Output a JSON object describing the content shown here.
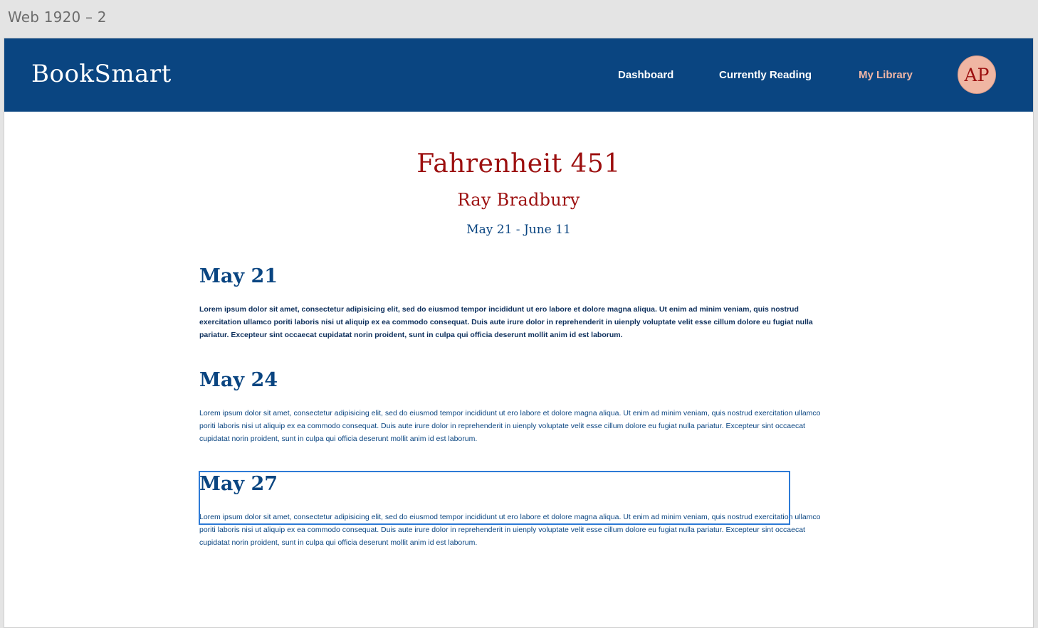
{
  "canvas": {
    "label": "Web 1920 – 2"
  },
  "navbar": {
    "brand": "BookSmart",
    "links": [
      {
        "label": "Dashboard"
      },
      {
        "label": "Currently Reading"
      },
      {
        "label": "My Library"
      }
    ],
    "avatar_initials": "AP"
  },
  "book": {
    "title": "Fahrenheit 451",
    "author": "Ray Bradbury",
    "dates": "May 21 - June 11"
  },
  "entries": [
    {
      "date": "May 21",
      "text": "Lorem ipsum dolor sit amet, consectetur adipisicing elit, sed do eiusmod tempor incididunt ut ero labore et dolore magna aliqua. Ut enim ad minim veniam, quis nostrud exercitation ullamco poriti laboris nisi ut aliquip ex ea commodo consequat. Duis aute irure dolor in reprehenderit in uienply voluptate velit esse cillum dolore eu fugiat nulla pariatur. Excepteur sint occaecat cupidatat norin proident, sunt in culpa qui officia deserunt mollit anim id est laborum."
    },
    {
      "date": "May 24",
      "text": "Lorem ipsum dolor sit amet, consectetur adipisicing elit, sed do eiusmod tempor incididunt ut ero labore et dolore magna aliqua. Ut enim ad minim veniam, quis nostrud exercitation ullamco poriti laboris nisi ut aliquip ex ea commodo consequat. Duis aute irure dolor in reprehenderit in uienply voluptate velit esse cillum dolore eu fugiat nulla pariatur. Excepteur sint occaecat cupidatat norin proident, sunt in culpa qui officia deserunt mollit anim id est laborum."
    },
    {
      "date": "May 27",
      "text": "Lorem ipsum dolor sit amet, consectetur adipisicing elit, sed do eiusmod tempor incididunt ut ero labore et dolore magna aliqua. Ut enim ad minim veniam, quis nostrud exercitation ullamco poriti laboris nisi ut aliquip ex ea commodo consequat. Duis aute irure dolor in reprehenderit in uienply voluptate velit esse cillum dolore eu fugiat nulla pariatur. Excepteur sint occaecat cupidatat norin proident, sunt in culpa qui officia deserunt mollit anim id est laborum."
    }
  ],
  "colors": {
    "navbar_bg": "#0a4581",
    "accent_red": "#9c0f0f",
    "active_link": "#f2b7a6",
    "avatar_bg": "#f0b6a3",
    "selection": "#2d7ad6"
  }
}
